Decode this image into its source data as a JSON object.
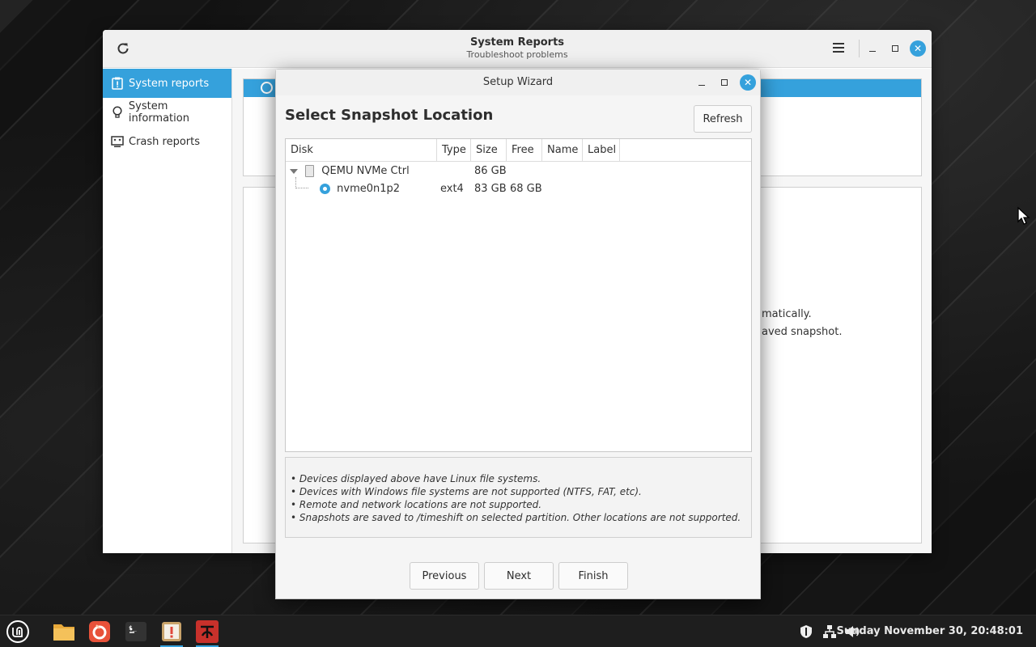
{
  "main_window": {
    "title": "System Reports",
    "subtitle": "Troubleshoot problems",
    "sidebar": [
      {
        "label": "System reports",
        "icon": "report-icon",
        "active": true
      },
      {
        "label": "System information",
        "icon": "lightbulb-icon",
        "active": false
      },
      {
        "label": "Crash reports",
        "icon": "crash-monitor-icon",
        "active": false
      }
    ],
    "background_text": [
      "matically.",
      "aved snapshot."
    ]
  },
  "wizard": {
    "title": "Setup Wizard",
    "heading": "Select Snapshot Location",
    "refresh_label": "Refresh",
    "columns": [
      "Disk",
      "Type",
      "Size",
      "Free",
      "Name",
      "Label"
    ],
    "rows": [
      {
        "disk": "QEMU NVMe Ctrl",
        "type": "",
        "size": "86 GB",
        "free": "",
        "name": "",
        "label": "",
        "level": 0
      },
      {
        "disk": "nvme0n1p2",
        "type": "ext4",
        "size": "83 GB",
        "free": "68 GB",
        "name": "",
        "label": "",
        "level": 1,
        "selected": true
      }
    ],
    "notes": [
      "• Devices displayed above have Linux file systems.",
      "• Devices with Windows file systems are not supported (NTFS, FAT, etc).",
      "• Remote and network locations are not supported.",
      "• Snapshots are saved to /timeshift on selected partition. Other locations are not supported."
    ],
    "buttons": {
      "previous": "Previous",
      "next": "Next",
      "finish": "Finish"
    }
  },
  "taskbar": {
    "apps": [
      "mint-menu-icon",
      "files-icon",
      "firefox-icon",
      "terminal-icon",
      "system-reports-icon",
      "timeshift-icon"
    ],
    "clock": "Sunday November 30, 20:48:01"
  },
  "colors": {
    "accent": "#35a1dc"
  }
}
